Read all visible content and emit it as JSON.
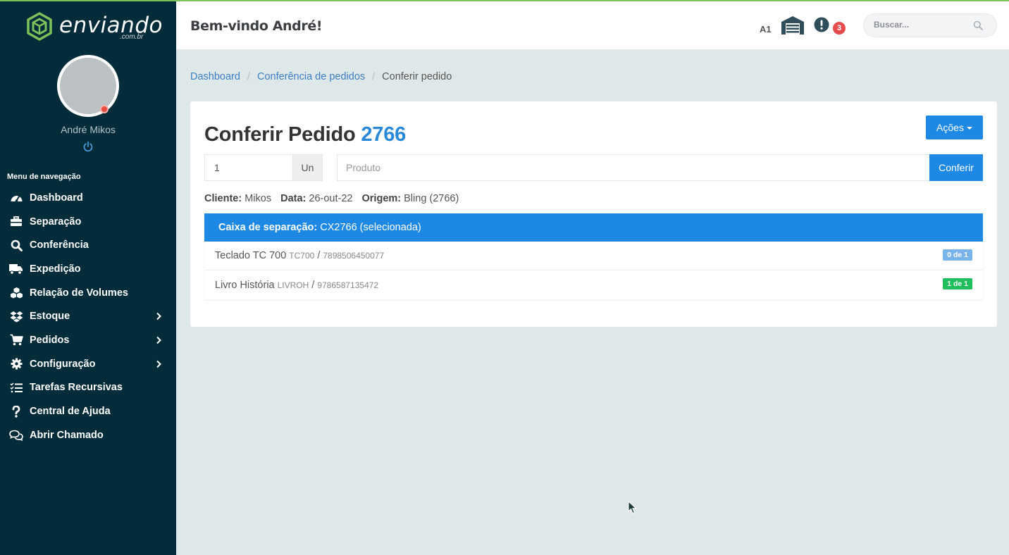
{
  "brand": {
    "name": "enviando",
    "sub": ".com.br",
    "accent": "#7cc25a"
  },
  "user": {
    "name": "André Mikos",
    "status_color": "#e74c3c"
  },
  "sidebar": {
    "menu_title": "Menu de navegação",
    "items": [
      {
        "label": "Dashboard",
        "icon": "speedometer-icon",
        "has_submenu": false
      },
      {
        "label": "Separação",
        "icon": "briefcase-icon",
        "has_submenu": false
      },
      {
        "label": "Conferência",
        "icon": "search-icon",
        "has_submenu": false
      },
      {
        "label": "Expedição",
        "icon": "truck-icon",
        "has_submenu": false
      },
      {
        "label": "Relação de Volumes",
        "icon": "boxes-icon",
        "has_submenu": false
      },
      {
        "label": "Estoque",
        "icon": "dropbox-icon",
        "has_submenu": true
      },
      {
        "label": "Pedidos",
        "icon": "cart-icon",
        "has_submenu": true
      },
      {
        "label": "Configuração",
        "icon": "gear-icon",
        "has_submenu": true
      },
      {
        "label": "Tarefas Recursivas",
        "icon": "tasks-icon",
        "has_submenu": false
      },
      {
        "label": "Central de Ajuda",
        "icon": "question-icon",
        "has_submenu": false
      },
      {
        "label": "Abrir Chamado",
        "icon": "chat-icon",
        "has_submenu": false
      }
    ]
  },
  "header": {
    "welcome": "Bem-vindo André!",
    "warehouse_code": "A1",
    "alert_count": "3",
    "search_placeholder": "Buscar..."
  },
  "breadcrumb": {
    "items": [
      "Dashboard",
      "Conferência de pedidos"
    ],
    "current": "Conferir pedido"
  },
  "order": {
    "title": "Conferir Pedido",
    "number": "2766",
    "actions_label": "Ações",
    "quantity_value": "1",
    "unit_label": "Un",
    "product_placeholder": "Produto",
    "check_button": "Conferir",
    "cliente_label": "Cliente:",
    "cliente": "Mikos",
    "data_label": "Data:",
    "data": "26-out-22",
    "origem_label": "Origem:",
    "origem": "Bling (2766)",
    "box_label": "Caixa de separação:",
    "box_value": "CX2766 (selecionada)",
    "items": [
      {
        "name": "Teclado TC 700",
        "sku": "TC700",
        "ean": "7898506450077",
        "progress": "0 de 1",
        "badge_color": "#7ab3ea"
      },
      {
        "name": "Livro História",
        "sku": "LIVROH",
        "ean": "9786587135472",
        "progress": "1 de 1",
        "badge_color": "#1fbf5f"
      }
    ]
  }
}
